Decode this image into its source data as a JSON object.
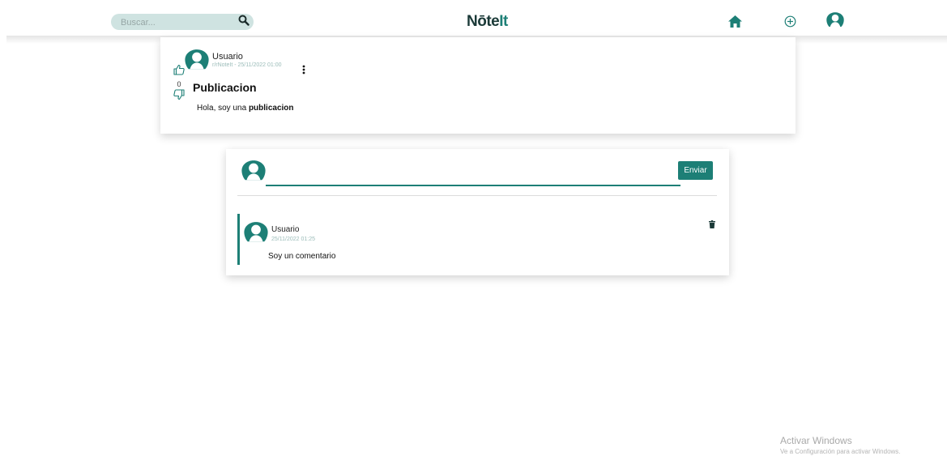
{
  "header": {
    "search_placeholder": "Buscar...",
    "logo_main": "Nōte",
    "logo_accent": "It",
    "icons": [
      "search-icon",
      "home-icon",
      "add-circle-icon",
      "user-avatar-icon"
    ]
  },
  "post": {
    "user": "Usuario",
    "meta": "r/rNoteIt - 25/11/2022 01:00",
    "votes": "0",
    "title": "Publicacion",
    "body_prefix": "Hola, soy una ",
    "body_bold": "publicacion"
  },
  "comment_form": {
    "input_value": "",
    "send_label": "Enviar"
  },
  "comments": [
    {
      "user": "Usuario",
      "time": "25/11/2022 01:25",
      "text": "Soy un comentario"
    }
  ],
  "watermark": {
    "title": "Activar Windows",
    "subtitle": "Ve a Configuración para activar Windows."
  },
  "colors": {
    "accent": "#1d7f76",
    "search_bg": "#cfe3e1",
    "meta_text": "#9bbcb9"
  }
}
